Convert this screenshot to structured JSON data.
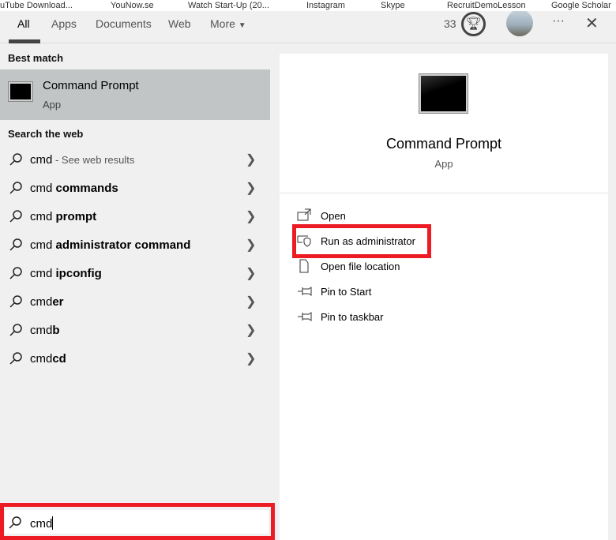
{
  "bookmarks": [
    "uTube Download...",
    "YouNow.se",
    "Watch Start-Up (20...",
    "Instagram",
    "Skype",
    "RecruitDemoLesson",
    "Google Scholar"
  ],
  "tabs": [
    {
      "label": "All",
      "active": true
    },
    {
      "label": "Apps"
    },
    {
      "label": "Documents"
    },
    {
      "label": "Web"
    },
    {
      "label": "More"
    }
  ],
  "header": {
    "points": "33",
    "icons": [
      "trophy-icon",
      "avatar",
      "more-icon",
      "close-icon"
    ]
  },
  "best_match": {
    "heading": "Best match",
    "title": "Command Prompt",
    "subtitle": "App"
  },
  "web": {
    "heading": "Search the web",
    "items": [
      {
        "plain": "cmd",
        "bold": "",
        "sub": " - See web results"
      },
      {
        "plain": "cmd ",
        "bold": "commands",
        "sub": ""
      },
      {
        "plain": "cmd ",
        "bold": "prompt",
        "sub": ""
      },
      {
        "plain": "cmd ",
        "bold": "administrator command",
        "sub": ""
      },
      {
        "plain": "cmd ",
        "bold": "ipconfig",
        "sub": ""
      },
      {
        "plain": "cmd",
        "bold": "er",
        "sub": ""
      },
      {
        "plain": "cmd",
        "bold": "b",
        "sub": ""
      },
      {
        "plain": "cmd",
        "bold": "cd",
        "sub": ""
      }
    ]
  },
  "detail": {
    "title": "Command Prompt",
    "subtitle": "App",
    "actions": [
      {
        "label": "Open",
        "icon": "open-icon"
      },
      {
        "label": "Run as administrator",
        "icon": "shield-icon"
      },
      {
        "label": "Open file location",
        "icon": "folder-icon"
      },
      {
        "label": "Pin to Start",
        "icon": "pin-icon"
      },
      {
        "label": "Pin to taskbar",
        "icon": "pin-icon"
      }
    ]
  },
  "search": {
    "value": "cmd"
  },
  "highlight_color": "#ed1c24"
}
